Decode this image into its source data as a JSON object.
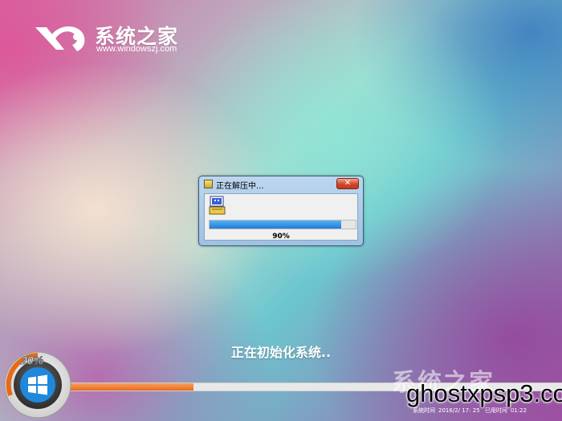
{
  "logo": {
    "title": "系统之家",
    "url": "www.windowszj.com"
  },
  "dialog": {
    "title": "正在解压中...",
    "close_label": "✕",
    "progress_value": 0.9,
    "progress_text": "90%"
  },
  "status_text": "正在初始化系统..",
  "bottom_progress": {
    "percent_label": "20%",
    "fill_fraction": 0.25
  },
  "watermark": {
    "ghost_text": "系统之家",
    "text": "ghostxpsp3.com"
  },
  "footer": {
    "system_time_label": "系统时间",
    "system_time_value": "2016/2/  17:  25",
    "elapsed_label": "已用时间",
    "elapsed_value": "01:22"
  },
  "colors": {
    "progress_blue": "#1f7bd9",
    "progress_orange": "#e76b1a",
    "close_red": "#d2452a"
  },
  "icons": [
    "logo-icon",
    "windows-icon",
    "app-icon",
    "close-icon"
  ]
}
